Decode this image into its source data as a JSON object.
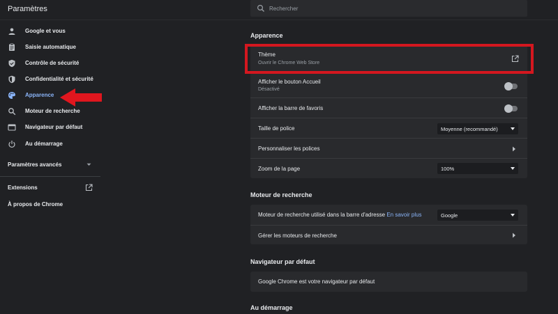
{
  "header": {
    "title": "Paramètres",
    "search_placeholder": "Rechercher"
  },
  "sidebar": {
    "items": [
      {
        "label": "Google et vous",
        "icon": "person-icon",
        "active": false
      },
      {
        "label": "Saisie automatique",
        "icon": "clipboard-icon",
        "active": false
      },
      {
        "label": "Contrôle de sécurité",
        "icon": "shield-check-icon",
        "active": false
      },
      {
        "label": "Confidentialité et sécurité",
        "icon": "shield-lock-icon",
        "active": false
      },
      {
        "label": "Apparence",
        "icon": "palette-icon",
        "active": true
      },
      {
        "label": "Moteur de recherche",
        "icon": "search-icon",
        "active": false
      },
      {
        "label": "Navigateur par défaut",
        "icon": "browser-window-icon",
        "active": false
      },
      {
        "label": "Au démarrage",
        "icon": "power-icon",
        "active": false
      }
    ],
    "advanced": "Paramètres avancés",
    "extensions": "Extensions",
    "about": "À propos de Chrome"
  },
  "appearance": {
    "title": "Apparence",
    "theme_label": "Thème",
    "theme_sub": "Ouvrir le Chrome Web Store",
    "home_button_label": "Afficher le bouton Accueil",
    "home_button_sub": "Désactivé",
    "home_button_on": false,
    "bookmarks_bar_label": "Afficher la barre de favoris",
    "bookmarks_bar_on": false,
    "font_size_label": "Taille de police",
    "font_size_value": "Moyenne (recommandé)",
    "customize_fonts_label": "Personnaliser les polices",
    "zoom_label": "Zoom de la page",
    "zoom_value": "100%"
  },
  "search_engine": {
    "title": "Moteur de recherche",
    "engine_label": "Moteur de recherche utilisé dans la barre d'adresse",
    "learn_more": "En savoir plus",
    "engine_value": "Google",
    "manage_label": "Gérer les moteurs de recherche"
  },
  "default_browser": {
    "title": "Navigateur par défaut",
    "status": "Google Chrome est votre navigateur par défaut"
  },
  "on_startup": {
    "title": "Au démarrage"
  },
  "colors": {
    "background": "#202124",
    "card": "#292a2d",
    "accent": "#8ab4f8",
    "highlight": "#d4171f"
  }
}
